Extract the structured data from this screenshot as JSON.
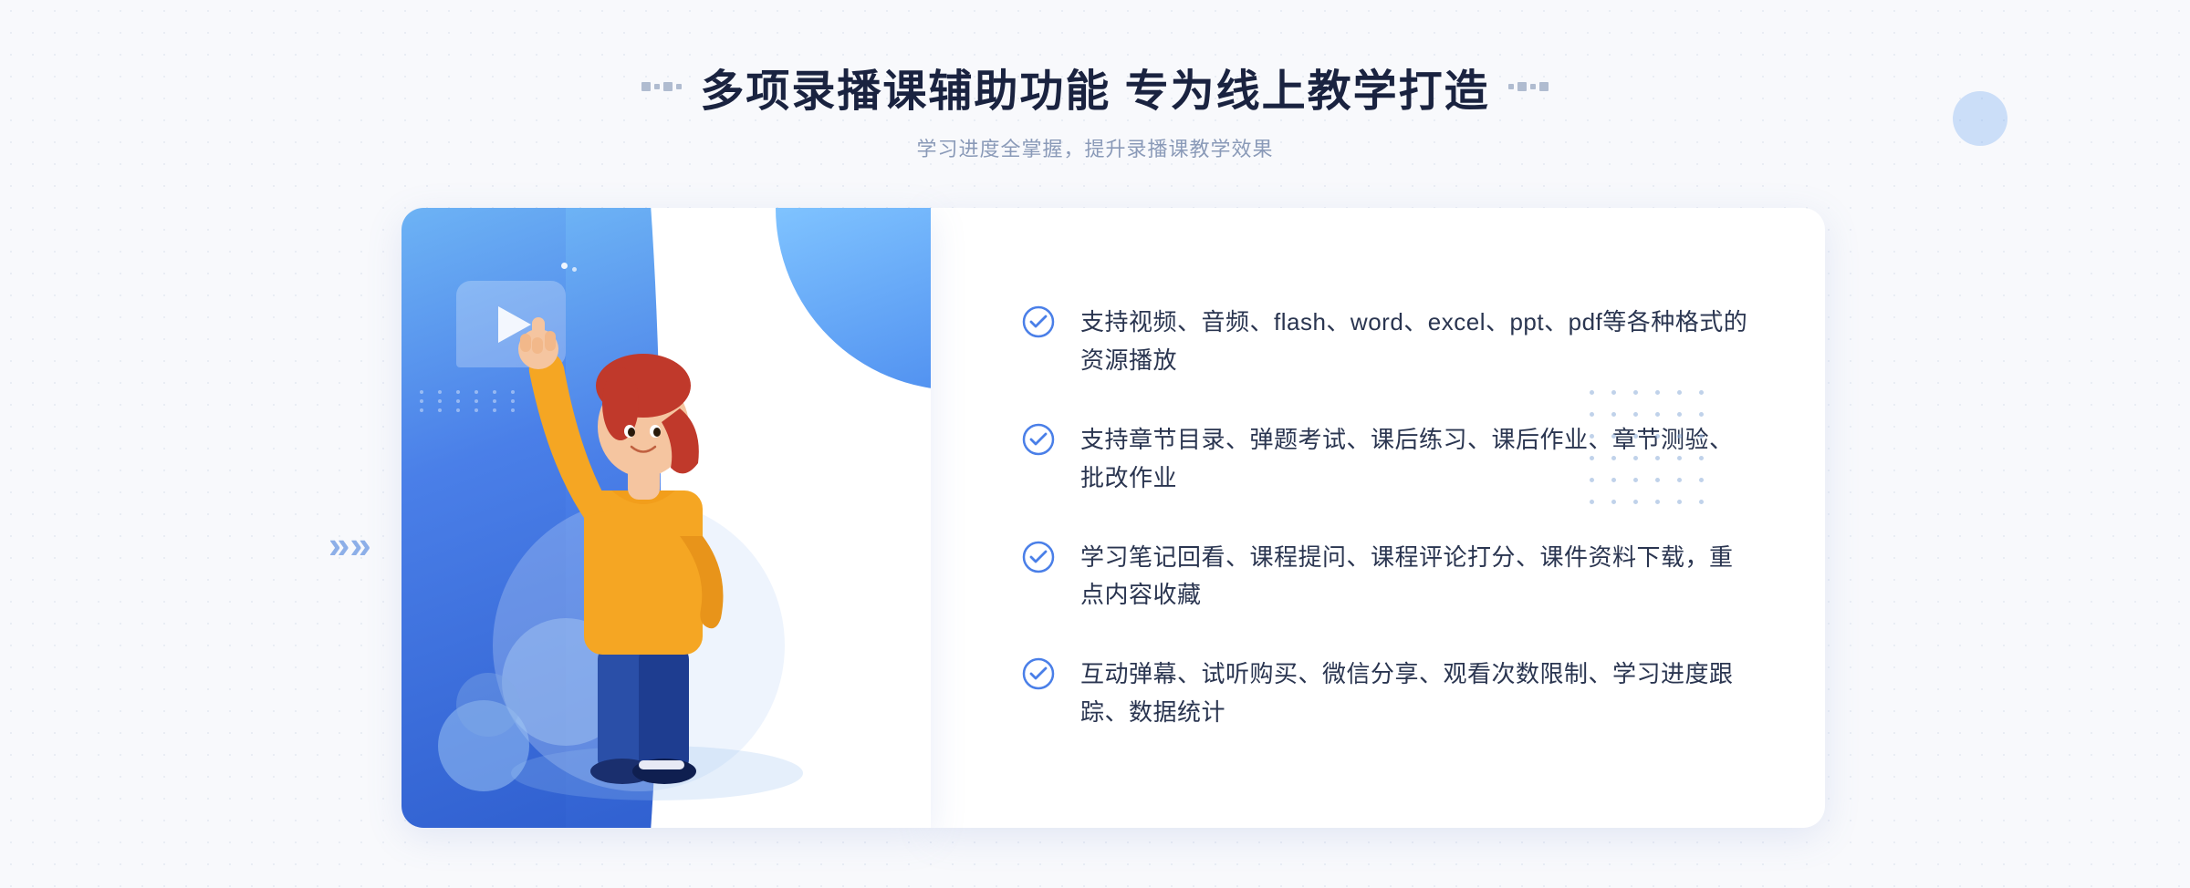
{
  "header": {
    "title": "多项录播课辅助功能 专为线上教学打造",
    "subtitle": "学习进度全掌握，提升录播课教学效果",
    "decorator_left": "⁞⁞",
    "decorator_right": "⁞⁞"
  },
  "features": [
    {
      "id": 1,
      "text": "支持视频、音频、flash、word、excel、ppt、pdf等各种格式的资源播放"
    },
    {
      "id": 2,
      "text": "支持章节目录、弹题考试、课后练习、课后作业、章节测验、批改作业"
    },
    {
      "id": 3,
      "text": "学习笔记回看、课程提问、课程评论打分、课件资料下载，重点内容收藏"
    },
    {
      "id": 4,
      "text": "互动弹幕、试听购买、微信分享、观看次数限制、学习进度跟踪、数据统计"
    }
  ],
  "colors": {
    "primary_blue": "#4a7fe8",
    "light_blue": "#6db3f5",
    "dark_blue": "#3060d0",
    "text_dark": "#2a3550",
    "text_light": "#8a9ab8",
    "check_color": "#4a7fe8",
    "background": "#f8f9fc"
  }
}
